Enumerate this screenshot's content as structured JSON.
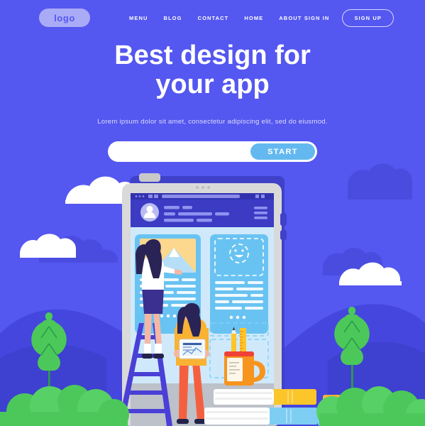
{
  "theme": {
    "background": "#5457f0",
    "background_dark": "#4345d8",
    "background_darker": "#3f41c9",
    "cloud_white": "#ffffff",
    "cloud_blue": "#4a4ce0",
    "accent_start": "#63b9ef",
    "logo_pill": "#a9abf7",
    "text_white": "#ffffff",
    "text_muted": "#dbdcfb",
    "green_leaf": "#4cc85a",
    "green_bush": "#57d066",
    "phone_body": "#d7d7d7",
    "screen_blue": "#cfe9fb",
    "header_indigo": "#3b3bc4",
    "card_blue": "#63c2f2",
    "mug_orange": "#f7941e",
    "book_yellow": "#fcc52a",
    "book_blue": "#7ecdf3",
    "ladder_purple": "#4a3fd6",
    "pants_red": "#f4603f",
    "hoodie_yellow": "#f9b233"
  },
  "navbar": {
    "logo": "logo",
    "links": [
      {
        "label": "MENU"
      },
      {
        "label": "BLOG"
      },
      {
        "label": "CONTACT"
      },
      {
        "label": "HOME"
      },
      {
        "label": "ABOUT"
      }
    ],
    "sign_in": "SIGN IN",
    "sign_up": "SIGN UP"
  },
  "hero": {
    "title_line1": "Best design for",
    "title_line2": "your app",
    "subtitle": "Lorem ipsum dolor sit amet, consectetur adipiscing elit, sed do eiusmod.",
    "search": {
      "value": "",
      "placeholder": ""
    },
    "cta_label": "START"
  },
  "illustration": {
    "name": "app-design-scene",
    "elements": [
      "tablet-device",
      "browser-header",
      "avatar",
      "image-card-mountains",
      "dashed-smiley-placeholder",
      "woman-on-ladder",
      "woman-with-laptop",
      "mug-with-pencil-and-ruler",
      "stack-of-books",
      "leaf-plant-left",
      "leaf-plant-right",
      "bushes"
    ]
  }
}
